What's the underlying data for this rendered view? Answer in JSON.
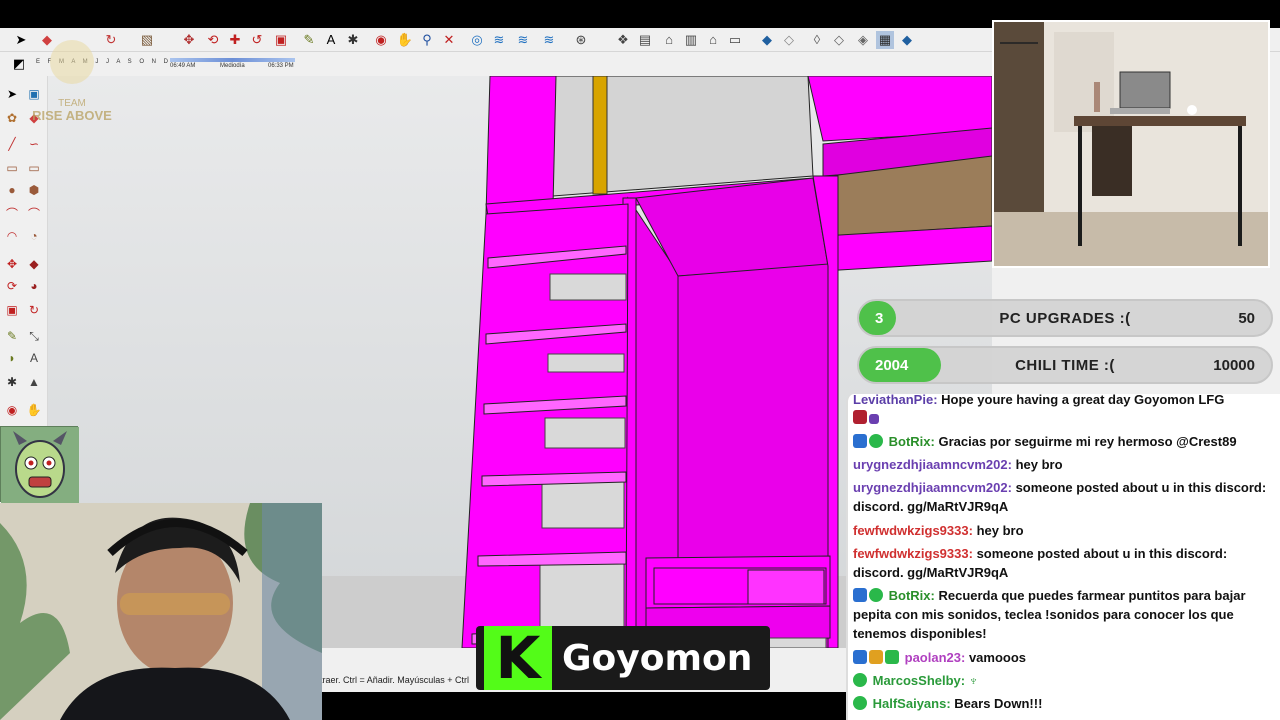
{
  "toolbar": {
    "tools": [
      "select",
      "eraser",
      "lasso",
      "rectangle",
      "move",
      "rotate",
      "scale",
      "tape",
      "text",
      "paint",
      "push",
      "orbit",
      "pan",
      "zoom",
      "zoom-extents",
      "iso",
      "top",
      "front",
      "right",
      "back",
      "left",
      "xray",
      "back-edges",
      "wireframe",
      "hidden-line",
      "shaded",
      "textured",
      "monochrome"
    ]
  },
  "shadows": {
    "months": "E F M A M J J A S O N D",
    "time_left": "06:49 AM",
    "time_mid": "Mediodía",
    "time_right": "06:33 PM"
  },
  "statusbar": {
    "hint": "traer. Ctrl = Añadir. Mayúsculas + Ctrl"
  },
  "goals": [
    {
      "current": "3",
      "title": "PC UPGRADES :(",
      "target": "50",
      "fraction": 0.06
    },
    {
      "current": "2004",
      "title": "CHILI TIME :(",
      "target": "10000",
      "fraction": 0.2
    }
  ],
  "chat": [
    {
      "user": "LeviathanPie:",
      "text": "Hope youre having a great day Goyomon LFG",
      "color": "#5b3ea8"
    },
    {
      "user": "BotRix:",
      "text": "Gracias por seguirme mi rey hermoso @Crest89",
      "color": "#2a8f2a"
    },
    {
      "user": "urygnezdhjiaamncvm202:",
      "text": "hey bro",
      "color": "#6a3fb0"
    },
    {
      "user": "urygnezdhjiaamncvm202:",
      "text": "someone posted about u in this discord: discord. gg/MaRtVJR9qA",
      "color": "#6a3fb0"
    },
    {
      "user": "fewfwdwkzigs9333:",
      "text": "hey bro",
      "color": "#d03030"
    },
    {
      "user": "fewfwdwkzigs9333:",
      "text": "someone posted about u in this discord: discord. gg/MaRtVJR9qA",
      "color": "#d03030"
    },
    {
      "user": "BotRix:",
      "text": "Recuerda que puedes farmear puntitos para bajar pepita con mis sonidos, teclea !sonidos para conocer los que tenemos disponibles!",
      "color": "#2a8f2a"
    },
    {
      "user": "paolan23:",
      "text": "vamooos",
      "color": "#b040c0"
    },
    {
      "user": "MarcosShelby:",
      "text": "",
      "color": "#2a9a3a"
    },
    {
      "user": "HalfSaiyans:",
      "text": "Bears Down!!!",
      "color": "#2a9a3a"
    }
  ],
  "banner": {
    "logo": "K",
    "name": "Goyomon"
  },
  "team_logo": {
    "line1": "TEAM",
    "line2": "RISE ABOVE"
  },
  "colors": {
    "magenta": "#ff00ff",
    "wood": "#9b7d5a",
    "kick_green": "#53fc18",
    "goal_green": "#4fc14a"
  }
}
